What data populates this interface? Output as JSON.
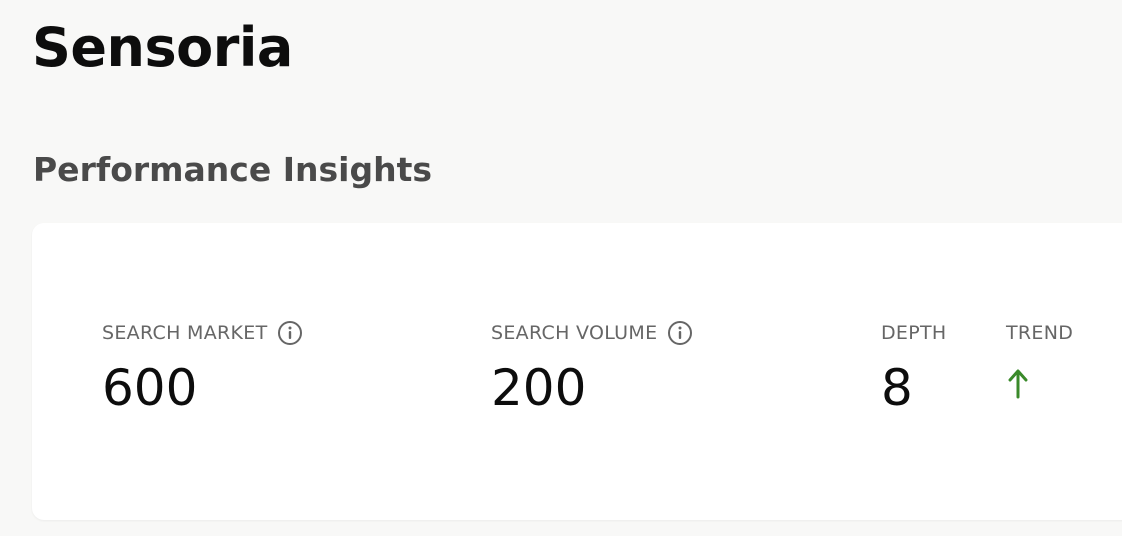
{
  "app": {
    "title": "Sensoria"
  },
  "section": {
    "title": "Performance Insights"
  },
  "metrics": [
    {
      "label": "SEARCH MARKET",
      "value": "600",
      "info_icon": "info-icon"
    },
    {
      "label": "SEARCH VOLUME",
      "value": "200",
      "info_icon": "info-icon"
    },
    {
      "label": "DEPTH",
      "value": "8"
    },
    {
      "label": "TREND",
      "icon": "arrow-up-icon",
      "color": "#3a8a2a"
    }
  ]
}
